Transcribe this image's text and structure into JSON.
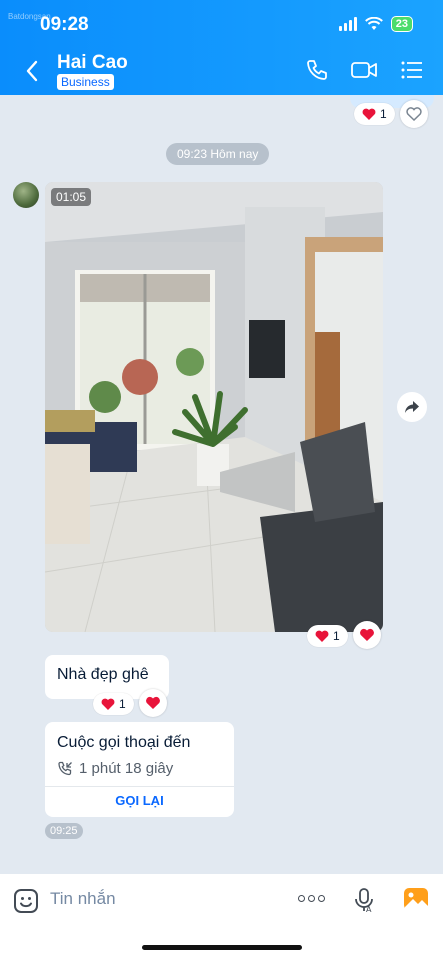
{
  "status_bar": {
    "time": "09:28",
    "watermark": "Batdongsan",
    "battery": "23"
  },
  "header": {
    "title": "Hai Cao",
    "badge": "Business"
  },
  "reactions": {
    "top_count": "1",
    "video_count": "1",
    "text_count": "1"
  },
  "divider": {
    "label": "09:23 Hôm nay"
  },
  "video": {
    "duration": "01:05"
  },
  "messages": {
    "text": "Nhà đẹp ghê"
  },
  "call": {
    "title": "Cuộc gọi thoại đến",
    "duration": "1 phút 18 giây",
    "action": "GỌI LẠI",
    "time": "09:25"
  },
  "input": {
    "placeholder": "Tin nhắn"
  },
  "colors": {
    "header_blue": "#0a8dfc",
    "heart_red": "#e8143a",
    "link_blue": "#0a68ff"
  }
}
